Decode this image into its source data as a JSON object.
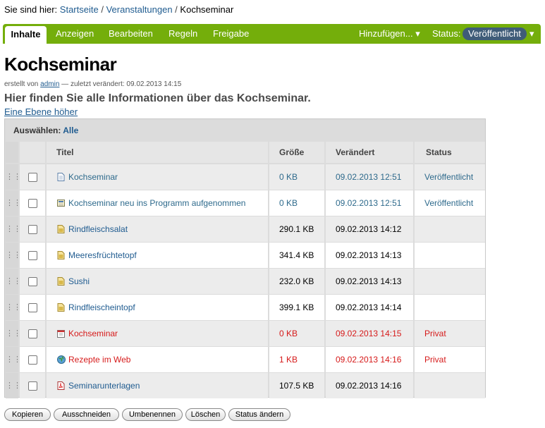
{
  "breadcrumb": {
    "prefix": "Sie sind hier:",
    "items": [
      "Startseite",
      "Veranstaltungen"
    ],
    "current": "Kochseminar",
    "separator": "/"
  },
  "editbar": {
    "tabs": [
      "Inhalte",
      "Anzeigen",
      "Bearbeiten",
      "Regeln",
      "Freigabe"
    ],
    "active_tab": "Inhalte",
    "add_menu": "Hinzufügen... ▾",
    "status_label": "Status:",
    "status_value": "Veröffentlicht",
    "status_arrow": "▾"
  },
  "page": {
    "title": "Kochseminar",
    "byline_created": "erstellt von",
    "byline_author": "admin",
    "byline_modified": "— zuletzt verändert: 09.02.2013 14:15",
    "description": "Hier finden Sie alle Informationen über das Kochseminar.",
    "up_link": "Eine Ebene höher"
  },
  "listing": {
    "select_label": "Auswählen:",
    "select_all": "Alle",
    "columns": [
      "Titel",
      "Größe",
      "Verändert",
      "Status"
    ],
    "rows": [
      {
        "title": "Kochseminar",
        "size": "0 KB",
        "modified": "09.02.2013 12:51",
        "status": "Veröffentlicht",
        "icon": "document-icon",
        "state": "published"
      },
      {
        "title": "Kochseminar neu ins Programm aufgenommen",
        "size": "0 KB",
        "modified": "09.02.2013 12:51",
        "status": "Veröffentlicht",
        "icon": "news-item-icon",
        "state": "published"
      },
      {
        "title": "Rindfleischsalat",
        "size": "290.1 KB",
        "modified": "09.02.2013 14:12",
        "status": "",
        "icon": "image-icon",
        "state": "none"
      },
      {
        "title": "Meeresfrüchtetopf",
        "size": "341.4 KB",
        "modified": "09.02.2013 14:13",
        "status": "",
        "icon": "image-icon",
        "state": "none"
      },
      {
        "title": "Sushi",
        "size": "232.0 KB",
        "modified": "09.02.2013 14:13",
        "status": "",
        "icon": "image-icon",
        "state": "none"
      },
      {
        "title": "Rindfleischeintopf",
        "size": "399.1 KB",
        "modified": "09.02.2013 14:14",
        "status": "",
        "icon": "image-icon",
        "state": "none"
      },
      {
        "title": "Kochseminar",
        "size": "0 KB",
        "modified": "09.02.2013 14:15",
        "status": "Privat",
        "icon": "event-icon",
        "state": "private"
      },
      {
        "title": "Rezepte im Web",
        "size": "1 KB",
        "modified": "09.02.2013 14:16",
        "status": "Privat",
        "icon": "link-globe-icon",
        "state": "private"
      },
      {
        "title": "Seminarunterlagen",
        "size": "107.5 KB",
        "modified": "09.02.2013 14:16",
        "status": "",
        "icon": "pdf-file-icon",
        "state": "none"
      }
    ]
  },
  "actions": [
    "Kopieren",
    "Ausschneiden",
    "Umbenennen",
    "Löschen",
    "Status ändern"
  ],
  "colors": {
    "editbar": "#74ae0b",
    "link": "#205c90",
    "private": "#d61a1a",
    "status_pill": "#3f5c78"
  }
}
